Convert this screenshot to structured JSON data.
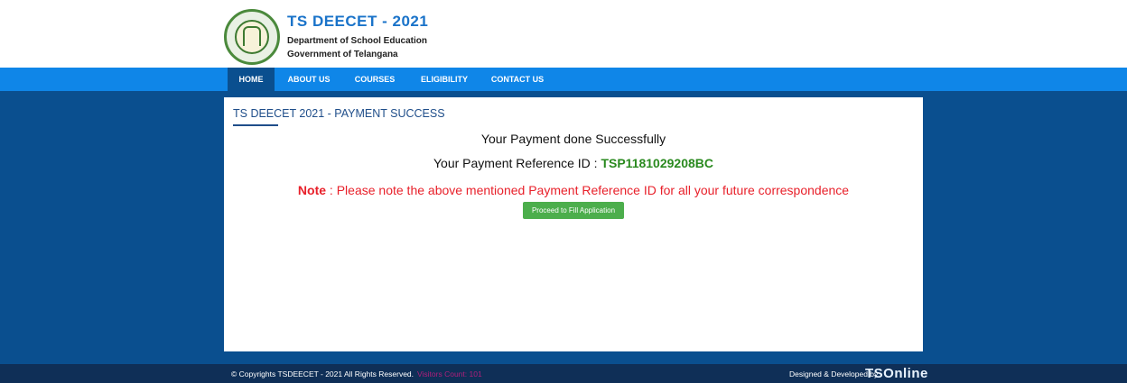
{
  "header": {
    "title": "TS DEECET - 2021",
    "subtitle1": "Department of School Education",
    "subtitle2": "Government of Telangana"
  },
  "nav": {
    "items": [
      {
        "label": "HOME",
        "active": true
      },
      {
        "label": "ABOUT US",
        "active": false
      },
      {
        "label": "COURSES",
        "active": false
      },
      {
        "label": "ELIGIBILITY",
        "active": false
      },
      {
        "label": "CONTACT US",
        "active": false
      }
    ]
  },
  "panel": {
    "title": "TS DEECET 2021 - PAYMENT SUCCESS",
    "message": "Your Payment done Successfully",
    "ref_label": "Your Payment Reference ID : ",
    "ref_id": "TSP1181029208BC",
    "note_label": "Note",
    "note_text": " : Please note the above mentioned Payment Reference ID for all your future correspondence",
    "button_label": "Proceed to Fill Application"
  },
  "footer": {
    "copyright": "© Copyrights TSDEECET - 2021 All Rights Reserved.",
    "visitors": "Visitors Count: 101",
    "designed_by": "Designed & Developed by",
    "brand": "TSOnline"
  },
  "colors": {
    "page_bg": "#0a4f8f",
    "nav_bg": "#0f86e8",
    "ref_id": "#2a8a1f",
    "note": "#e8202a",
    "button": "#4cae4c",
    "footer_bg": "#0f2f57"
  }
}
